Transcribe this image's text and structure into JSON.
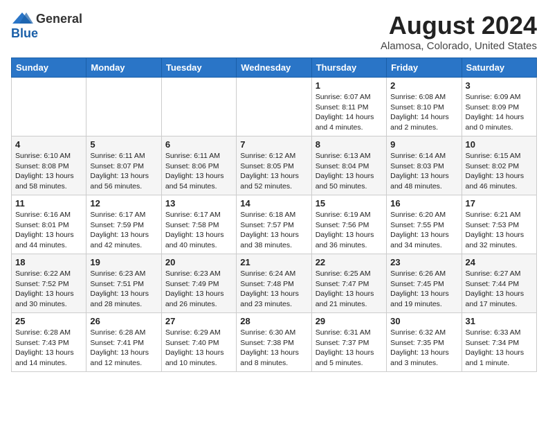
{
  "header": {
    "logo_general": "General",
    "logo_blue": "Blue",
    "month_year": "August 2024",
    "location": "Alamosa, Colorado, United States"
  },
  "days_of_week": [
    "Sunday",
    "Monday",
    "Tuesday",
    "Wednesday",
    "Thursday",
    "Friday",
    "Saturday"
  ],
  "weeks": [
    [
      {
        "day": "",
        "info": ""
      },
      {
        "day": "",
        "info": ""
      },
      {
        "day": "",
        "info": ""
      },
      {
        "day": "",
        "info": ""
      },
      {
        "day": "1",
        "info": "Sunrise: 6:07 AM\nSunset: 8:11 PM\nDaylight: 14 hours\nand 4 minutes."
      },
      {
        "day": "2",
        "info": "Sunrise: 6:08 AM\nSunset: 8:10 PM\nDaylight: 14 hours\nand 2 minutes."
      },
      {
        "day": "3",
        "info": "Sunrise: 6:09 AM\nSunset: 8:09 PM\nDaylight: 14 hours\nand 0 minutes."
      }
    ],
    [
      {
        "day": "4",
        "info": "Sunrise: 6:10 AM\nSunset: 8:08 PM\nDaylight: 13 hours\nand 58 minutes."
      },
      {
        "day": "5",
        "info": "Sunrise: 6:11 AM\nSunset: 8:07 PM\nDaylight: 13 hours\nand 56 minutes."
      },
      {
        "day": "6",
        "info": "Sunrise: 6:11 AM\nSunset: 8:06 PM\nDaylight: 13 hours\nand 54 minutes."
      },
      {
        "day": "7",
        "info": "Sunrise: 6:12 AM\nSunset: 8:05 PM\nDaylight: 13 hours\nand 52 minutes."
      },
      {
        "day": "8",
        "info": "Sunrise: 6:13 AM\nSunset: 8:04 PM\nDaylight: 13 hours\nand 50 minutes."
      },
      {
        "day": "9",
        "info": "Sunrise: 6:14 AM\nSunset: 8:03 PM\nDaylight: 13 hours\nand 48 minutes."
      },
      {
        "day": "10",
        "info": "Sunrise: 6:15 AM\nSunset: 8:02 PM\nDaylight: 13 hours\nand 46 minutes."
      }
    ],
    [
      {
        "day": "11",
        "info": "Sunrise: 6:16 AM\nSunset: 8:01 PM\nDaylight: 13 hours\nand 44 minutes."
      },
      {
        "day": "12",
        "info": "Sunrise: 6:17 AM\nSunset: 7:59 PM\nDaylight: 13 hours\nand 42 minutes."
      },
      {
        "day": "13",
        "info": "Sunrise: 6:17 AM\nSunset: 7:58 PM\nDaylight: 13 hours\nand 40 minutes."
      },
      {
        "day": "14",
        "info": "Sunrise: 6:18 AM\nSunset: 7:57 PM\nDaylight: 13 hours\nand 38 minutes."
      },
      {
        "day": "15",
        "info": "Sunrise: 6:19 AM\nSunset: 7:56 PM\nDaylight: 13 hours\nand 36 minutes."
      },
      {
        "day": "16",
        "info": "Sunrise: 6:20 AM\nSunset: 7:55 PM\nDaylight: 13 hours\nand 34 minutes."
      },
      {
        "day": "17",
        "info": "Sunrise: 6:21 AM\nSunset: 7:53 PM\nDaylight: 13 hours\nand 32 minutes."
      }
    ],
    [
      {
        "day": "18",
        "info": "Sunrise: 6:22 AM\nSunset: 7:52 PM\nDaylight: 13 hours\nand 30 minutes."
      },
      {
        "day": "19",
        "info": "Sunrise: 6:23 AM\nSunset: 7:51 PM\nDaylight: 13 hours\nand 28 minutes."
      },
      {
        "day": "20",
        "info": "Sunrise: 6:23 AM\nSunset: 7:49 PM\nDaylight: 13 hours\nand 26 minutes."
      },
      {
        "day": "21",
        "info": "Sunrise: 6:24 AM\nSunset: 7:48 PM\nDaylight: 13 hours\nand 23 minutes."
      },
      {
        "day": "22",
        "info": "Sunrise: 6:25 AM\nSunset: 7:47 PM\nDaylight: 13 hours\nand 21 minutes."
      },
      {
        "day": "23",
        "info": "Sunrise: 6:26 AM\nSunset: 7:45 PM\nDaylight: 13 hours\nand 19 minutes."
      },
      {
        "day": "24",
        "info": "Sunrise: 6:27 AM\nSunset: 7:44 PM\nDaylight: 13 hours\nand 17 minutes."
      }
    ],
    [
      {
        "day": "25",
        "info": "Sunrise: 6:28 AM\nSunset: 7:43 PM\nDaylight: 13 hours\nand 14 minutes."
      },
      {
        "day": "26",
        "info": "Sunrise: 6:28 AM\nSunset: 7:41 PM\nDaylight: 13 hours\nand 12 minutes."
      },
      {
        "day": "27",
        "info": "Sunrise: 6:29 AM\nSunset: 7:40 PM\nDaylight: 13 hours\nand 10 minutes."
      },
      {
        "day": "28",
        "info": "Sunrise: 6:30 AM\nSunset: 7:38 PM\nDaylight: 13 hours\nand 8 minutes."
      },
      {
        "day": "29",
        "info": "Sunrise: 6:31 AM\nSunset: 7:37 PM\nDaylight: 13 hours\nand 5 minutes."
      },
      {
        "day": "30",
        "info": "Sunrise: 6:32 AM\nSunset: 7:35 PM\nDaylight: 13 hours\nand 3 minutes."
      },
      {
        "day": "31",
        "info": "Sunrise: 6:33 AM\nSunset: 7:34 PM\nDaylight: 13 hours\nand 1 minute."
      }
    ]
  ]
}
